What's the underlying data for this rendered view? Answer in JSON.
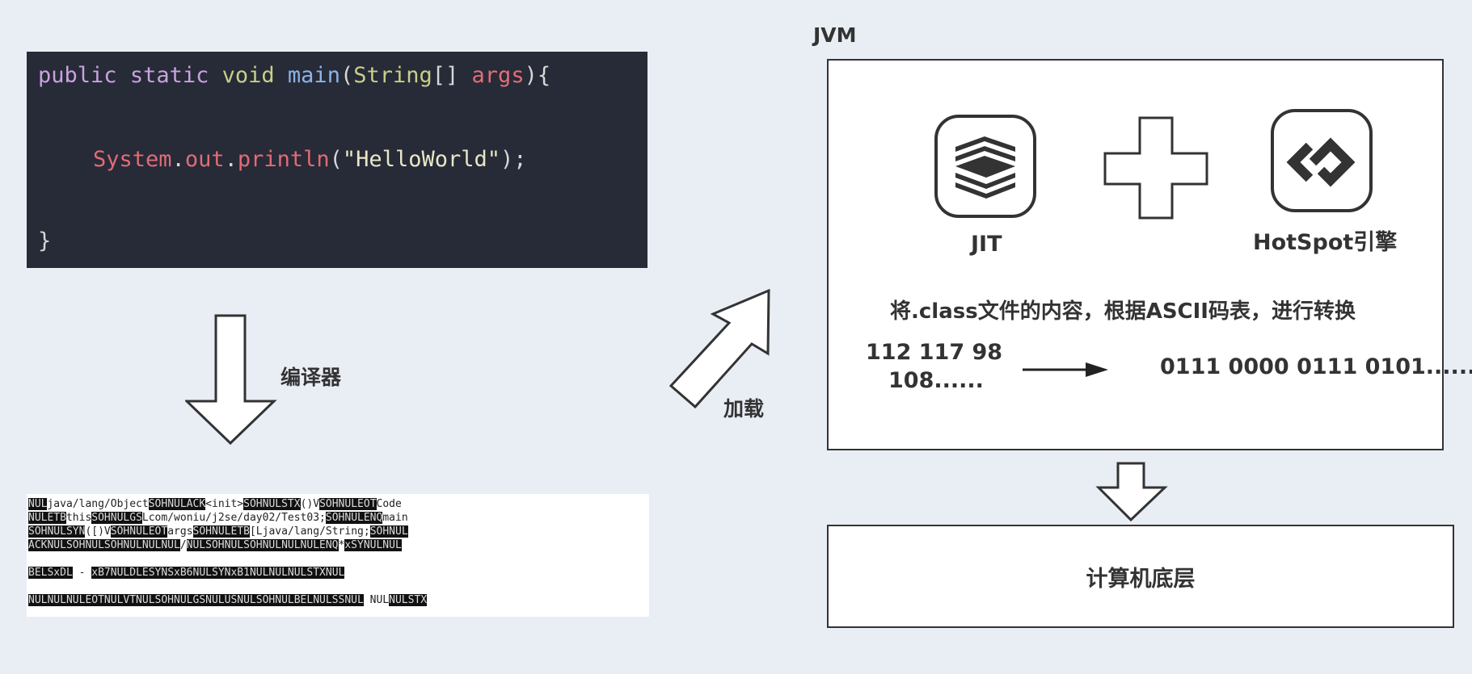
{
  "code": {
    "line1": {
      "kw_public": "public",
      "kw_static": "static",
      "kw_void": "void",
      "fn_main": "main",
      "paren_open": "(",
      "type_string": "String",
      "brackets": "[] ",
      "arg_name": "args",
      "close": "){"
    },
    "line2": {
      "system": "System",
      "dot1": ".",
      "out": "out",
      "dot2": ".",
      "println": "println",
      "paren_open": "(",
      "string": "\"HelloWorld\"",
      "close": ");"
    },
    "line3": {
      "brace": "}"
    }
  },
  "bytecode": {
    "lines": [
      [
        {
          "t": "NUL",
          "b": true
        },
        {
          "t": "java/lang/Object",
          "b": false
        },
        {
          "t": "SOHNULACK",
          "b": true
        },
        {
          "t": "<init>",
          "b": false
        },
        {
          "t": "SOHNULSTX",
          "b": true
        },
        {
          "t": "()V",
          "b": false
        },
        {
          "t": "SOHNULEOT",
          "b": true
        },
        {
          "t": "Code",
          "b": false
        }
      ],
      [
        {
          "t": "NULETB",
          "b": true
        },
        {
          "t": "this",
          "b": false
        },
        {
          "t": "SOHNULGS",
          "b": true
        },
        {
          "t": "Lcom/woniu/j2se/day02/Test03;",
          "b": false
        },
        {
          "t": "SOHNULENQ",
          "b": true
        },
        {
          "t": "main",
          "b": false
        }
      ],
      [
        {
          "t": "SOHNULSYN",
          "b": true
        },
        {
          "t": "([)V",
          "b": false
        },
        {
          "t": "SOHNULEOT",
          "b": true
        },
        {
          "t": "args",
          "b": false
        },
        {
          "t": "SOHNULETB",
          "b": true
        },
        {
          "t": "[Ljava/lang/String;",
          "b": false
        },
        {
          "t": "SOHNUL",
          "b": true
        }
      ],
      [
        {
          "t": "ACKNULSOHNULSOHNULNULNUL",
          "b": true
        },
        {
          "t": "/",
          "b": false
        },
        {
          "t": "NULSOHNULSOHNULNULNULENQ",
          "b": true
        },
        {
          "t": "*",
          "b": false
        },
        {
          "t": "xSYNULNUL",
          "b": true
        }
      ],
      [],
      [
        {
          "t": "BELSxDL",
          "b": true
        },
        {
          "t": " - ",
          "b": false
        },
        {
          "t": "xB7NULDLESYNSxB6NULSYNxB1NULNULNULSTXNUL",
          "b": true
        }
      ],
      [],
      [
        {
          "t": "NULNULNULEOTNULVTNULSOHNULGSNULUSNULSOHNULBELNULSSNUL",
          "b": true
        },
        {
          "t": " NUL",
          "b": false
        },
        {
          "t": "NULSTX",
          "b": true
        }
      ]
    ]
  },
  "labels": {
    "compiler": "编译器",
    "load": "加载",
    "jvm": "JVM",
    "jit": "JIT",
    "hotspot": "HotSpot引擎",
    "description": "将.class文件的内容，根据ASCII码表，进行转换",
    "ascii_line1": "112 117 98",
    "ascii_line2": "108......",
    "binary": "0111 0000   0111 0101......",
    "bottom": "计算机底层"
  }
}
